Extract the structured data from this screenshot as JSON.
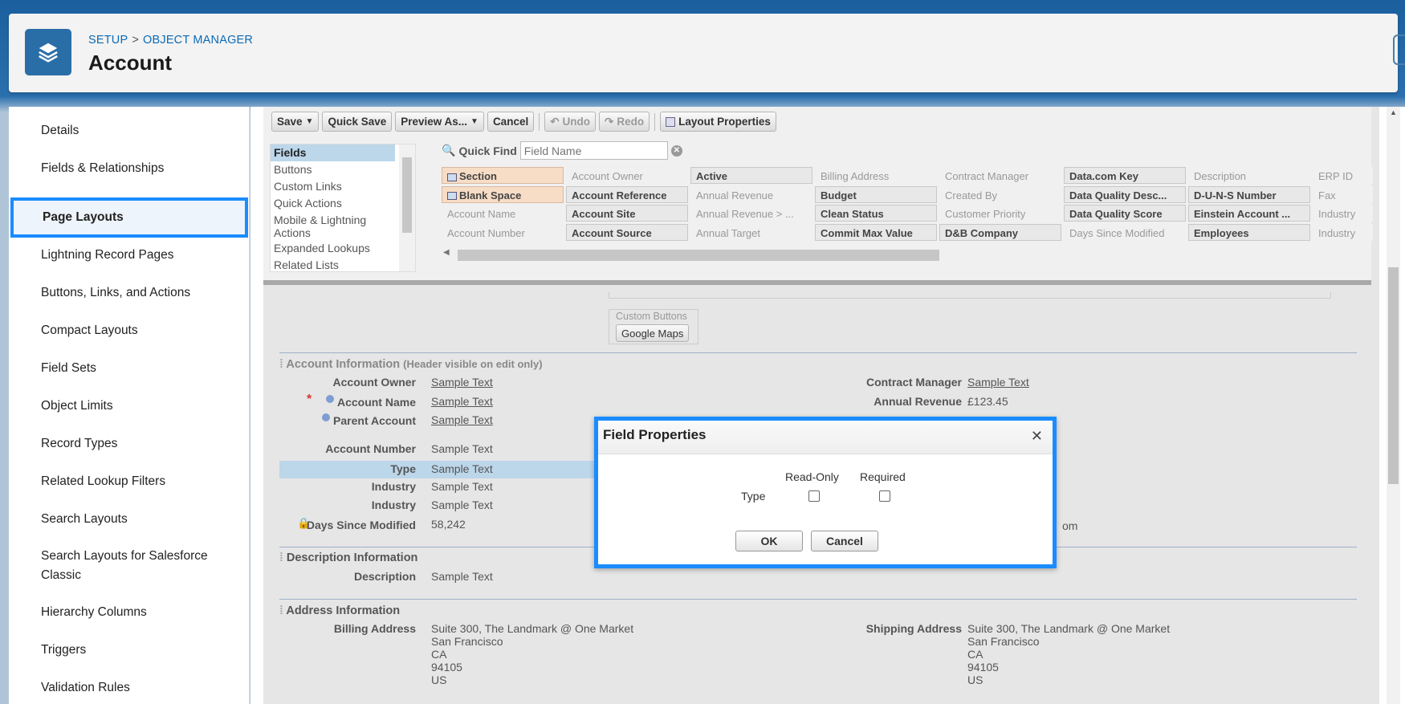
{
  "header": {
    "breadcrumb": [
      "SETUP",
      "OBJECT MANAGER"
    ],
    "breadcrumb_sep": ">",
    "title": "Account",
    "logo_icon": "layers-icon"
  },
  "sidebar": {
    "items": [
      {
        "label": "Details"
      },
      {
        "label": "Fields & Relationships"
      },
      {
        "label": "Page Layouts",
        "active": true
      },
      {
        "label": "Lightning Record Pages"
      },
      {
        "label": "Buttons, Links, and Actions"
      },
      {
        "label": "Compact Layouts"
      },
      {
        "label": "Field Sets"
      },
      {
        "label": "Object Limits"
      },
      {
        "label": "Record Types"
      },
      {
        "label": "Related Lookup Filters"
      },
      {
        "label": "Search Layouts"
      },
      {
        "label": "Search Layouts for Salesforce Classic"
      },
      {
        "label": "Hierarchy Columns"
      },
      {
        "label": "Triggers"
      },
      {
        "label": "Validation Rules"
      }
    ]
  },
  "toolbar": {
    "save": "Save",
    "quick_save": "Quick Save",
    "preview_as": "Preview As...",
    "cancel": "Cancel",
    "undo": "Undo",
    "redo": "Redo",
    "layout_properties": "Layout Properties"
  },
  "palette": {
    "categories": [
      "Fields",
      "Buttons",
      "Custom Links",
      "Quick Actions",
      "Mobile & Lightning Actions",
      "Expanded Lookups",
      "Related Lists"
    ],
    "selected_category": "Fields",
    "quick_find_label": "Quick Find",
    "quick_find_placeholder": "Field Name",
    "columns": [
      [
        "Section",
        "Blank Space",
        "Account Name",
        "Account Number"
      ],
      [
        "Account Owner",
        "Account Reference",
        "Account Site",
        "Account Source"
      ],
      [
        "Active",
        "Annual Revenue",
        "Annual Revenue > ...",
        "Annual Target"
      ],
      [
        "Billing Address",
        "Budget",
        "Clean Status",
        "Commit Max Value"
      ],
      [
        "Contract Manager",
        "Created By",
        "Customer Priority",
        "D&B Company"
      ],
      [
        "Data.com Key",
        "Data Quality Desc...",
        "Data Quality Score",
        "Days Since Modified"
      ],
      [
        "Description",
        "D-U-N-S Number",
        "Einstein Account ...",
        "Employees"
      ],
      [
        "ERP ID",
        "Fax",
        "Industry",
        "Industry"
      ]
    ],
    "available": [
      [
        false,
        false,
        false,
        false
      ],
      [
        false,
        true,
        true,
        true
      ],
      [
        true,
        false,
        false,
        false
      ],
      [
        false,
        true,
        true,
        true
      ],
      [
        false,
        false,
        false,
        true
      ],
      [
        true,
        true,
        true,
        false
      ],
      [
        false,
        true,
        true,
        true
      ],
      [
        false,
        false,
        false,
        false
      ]
    ]
  },
  "layout": {
    "custom_buttons_label": "Custom Buttons",
    "custom_button": "Google Maps",
    "account_info": {
      "title": "Account Information",
      "subtitle": "(Header visible on edit only)",
      "left": [
        {
          "label": "Account Owner",
          "value": "Sample Text",
          "link": true
        },
        {
          "label": "Account Name",
          "value": "Sample Text",
          "link": true,
          "required": true,
          "dot": true
        },
        {
          "label": "Parent Account",
          "value": "Sample Text",
          "link": true,
          "dot": true
        },
        {
          "label": "Account Number",
          "value": "Sample Text"
        },
        {
          "label": "Type",
          "value": "Sample Text",
          "highlighted": true
        },
        {
          "label": "Industry",
          "value": "Sample Text"
        },
        {
          "label": "Industry",
          "value": "Sample Text"
        },
        {
          "label": "Days Since Modified",
          "value": "58,242",
          "locked": true
        }
      ],
      "right": [
        {
          "label": "Contract Manager",
          "value": "Sample Text",
          "link": true
        },
        {
          "label": "Annual Revenue",
          "value": "£123.45"
        }
      ],
      "right_fragment": "om"
    },
    "description_info": {
      "title": "Description Information",
      "rows": [
        {
          "label": "Description",
          "value": "Sample Text"
        }
      ]
    },
    "address_info": {
      "title": "Address Information",
      "billing_label": "Billing Address",
      "billing_lines": [
        "Suite 300, The Landmark @ One Market",
        "San Francisco",
        "CA",
        "94105",
        "US"
      ],
      "shipping_label": "Shipping Address",
      "shipping_lines": [
        "Suite 300, The Landmark @ One Market",
        "San Francisco",
        "CA",
        "94105",
        "US"
      ]
    }
  },
  "modal": {
    "title": "Field Properties",
    "col_readonly": "Read-Only",
    "col_required": "Required",
    "field_name": "Type",
    "readonly_checked": false,
    "required_checked": false,
    "ok": "OK",
    "cancel": "Cancel"
  }
}
